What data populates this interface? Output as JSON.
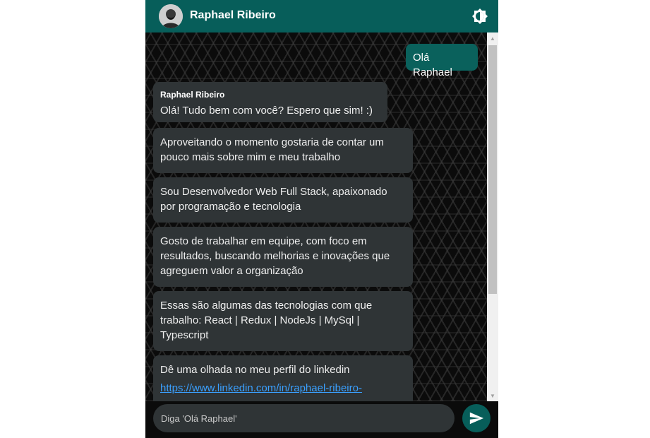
{
  "header": {
    "contact_name": "Raphael Ribeiro",
    "avatar_icon": "user-avatar-icon",
    "theme_icon": "brightness-contrast-icon"
  },
  "messages": {
    "sent": [
      {
        "text": "Olá Raphael"
      }
    ],
    "received": [
      {
        "sender": "Raphael Ribeiro",
        "text": "Olá! Tudo bem com você? Espero que sim! :)"
      },
      {
        "lines": [
          "Aproveitando o momento gostaria de contar um",
          "pouco mais sobre mim e meu trabalho"
        ]
      },
      {
        "lines": [
          "Sou Desenvolvedor Web Full Stack, apaixonado",
          "por programação e tecnologia"
        ]
      },
      {
        "lines": [
          "Gosto de trabalhar em equipe, com foco em",
          "resultados, buscando melhorias e inovações que",
          "agreguem valor a organização"
        ]
      },
      {
        "lines": [
          "Essas são algumas das tecnologias com que",
          "trabalho: React | Redux | NodeJs | MySql |",
          "Typescript"
        ]
      },
      {
        "text": "Dê uma olhada no meu perfil do linkedin",
        "link": "https://www.linkedin.com/in/raphael-ribeiro-"
      }
    ]
  },
  "composer": {
    "placeholder": "Diga 'Olá Raphael'",
    "value": "",
    "send_icon": "send-icon"
  },
  "colors": {
    "header": "#075e5a",
    "sent_bubble": "#0a615c",
    "received_bubble": "#2f3436",
    "link": "#3aa0ff"
  }
}
